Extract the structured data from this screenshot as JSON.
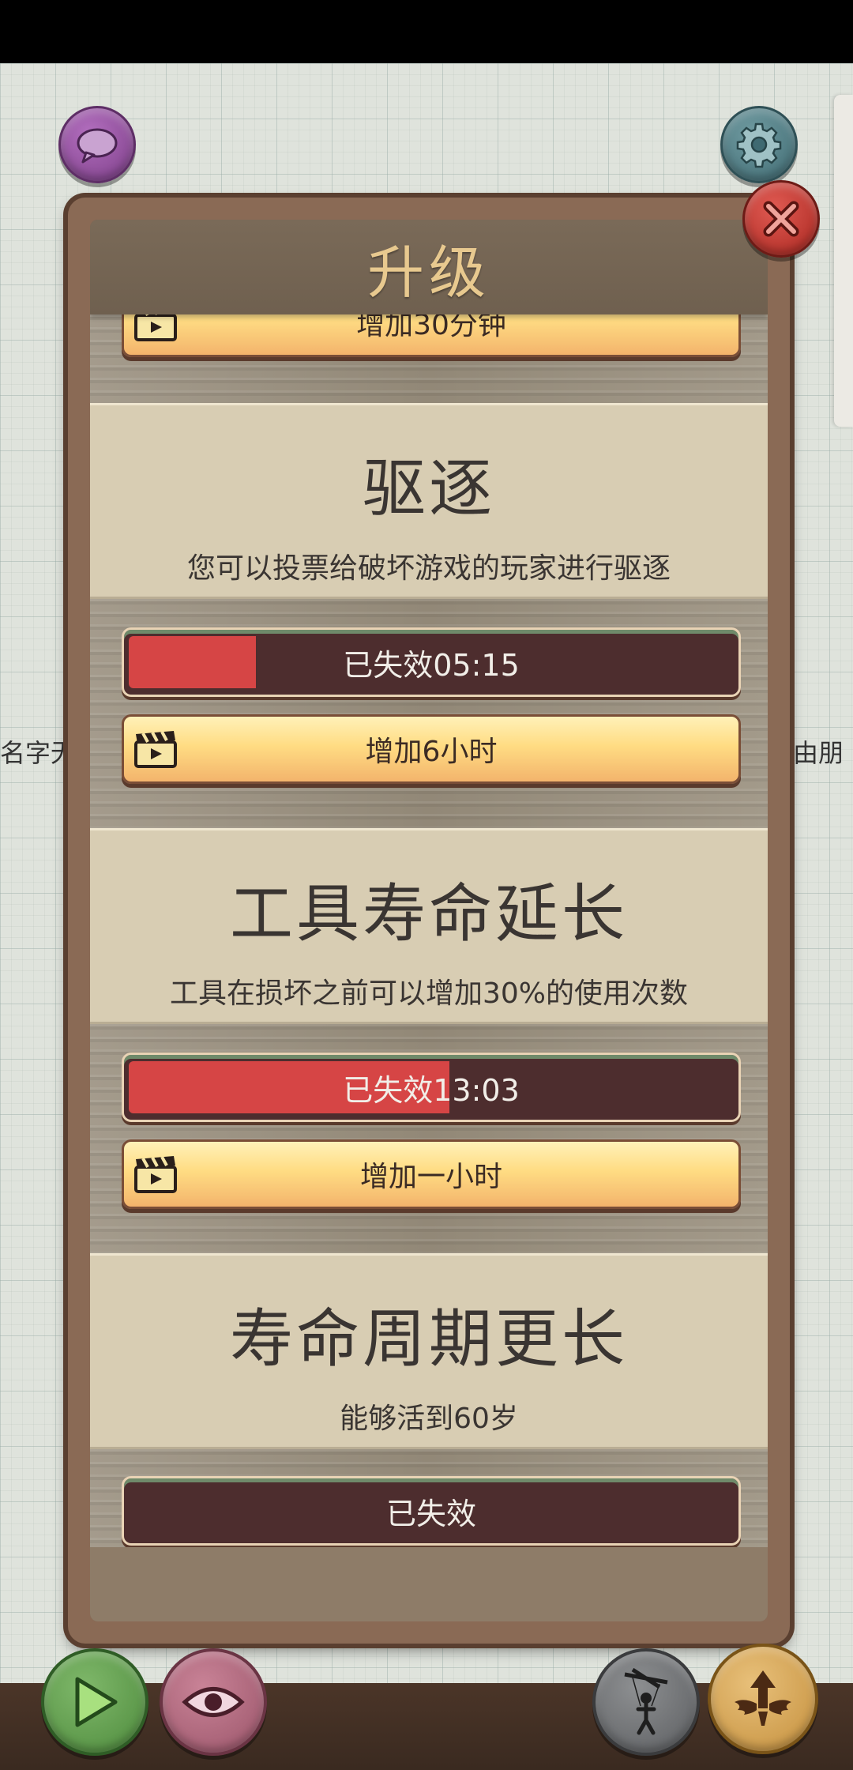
{
  "dialog": {
    "title": "升级",
    "partial_top_button": "增加30分钟",
    "sections": [
      {
        "title": "驱逐",
        "description": "您可以投票给破坏游戏的玩家进行驱逐",
        "status": "已失效05:15",
        "progress": 0.21,
        "action": "增加6小时"
      },
      {
        "title": "工具寿命延长",
        "description": "工具在损坏之前可以增加30%的使用次数",
        "status": "已失效13:03",
        "progress": 0.53,
        "action": "增加一小时"
      },
      {
        "title": "寿命周期更长",
        "description": "能够活到60岁",
        "status": "已失效",
        "progress": 0
      }
    ]
  },
  "background": {
    "left_text": "名字无",
    "right_text": "由朋"
  },
  "icons": {
    "chat": "chat-bubble-icon",
    "settings": "gear-icon",
    "close": "close-icon",
    "play": "play-icon",
    "view": "eye-icon",
    "puppet": "puppet-icon",
    "upgrade": "winged-arrow-icon",
    "video": "clapperboard-icon"
  },
  "colors": {
    "progress_fill": "#d64545",
    "progress_bg": "#4d2d2e",
    "title_text": "#e8c98f",
    "button_yellow": "#ffdc83"
  }
}
